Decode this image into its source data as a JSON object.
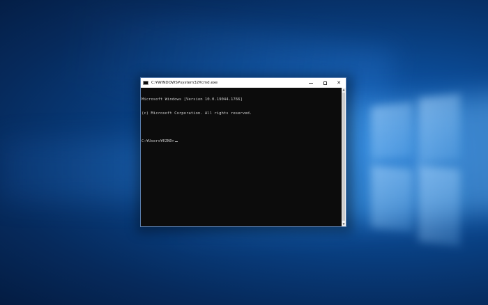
{
  "window": {
    "title": "C:¥WINDOWS¥system32¥cmd.exe",
    "icon": "cmd-icon",
    "controls": {
      "minimize_icon": "minimize-icon",
      "maximize_icon": "maximize-icon",
      "close_label": "✕"
    }
  },
  "console": {
    "lines": [
      "Microsoft Windows [Version 10.0.19044.1766]",
      "(c) Microsoft Corporation. All rights reserved.",
      "",
      "C:¥Users¥EZND>"
    ]
  },
  "scrollbar": {
    "up_label": "▲",
    "down_label": "▼"
  },
  "colors": {
    "console_bg": "#0c0c0c",
    "console_text": "#cccccc",
    "titlebar_bg": "#ffffff",
    "desktop_accent": "#0c4f9d"
  }
}
